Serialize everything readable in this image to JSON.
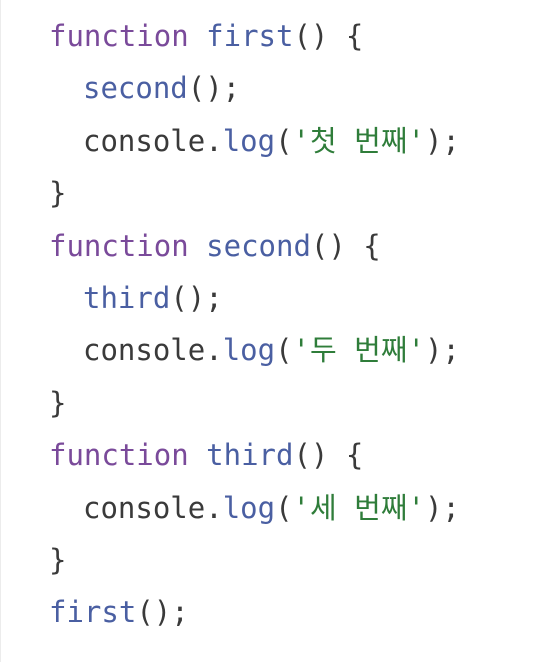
{
  "colors": {
    "background": "#ffffff",
    "keyword": "#7a4a9a",
    "function_name": "#4a5fa2",
    "plain": "#3a3a3a",
    "string": "#2f7d3a"
  },
  "code": {
    "line1": {
      "kw": "function",
      "name": "first",
      "rest": "() {"
    },
    "line2": {
      "call": "second",
      "rest": "();"
    },
    "line3": {
      "obj": "console",
      "dot": ".",
      "method": "log",
      "open": "(",
      "str": "'첫 번째'",
      "close": ");"
    },
    "line4": {
      "text": "}"
    },
    "line5": {
      "kw": "function",
      "name": "second",
      "rest": "() {"
    },
    "line6": {
      "call": "third",
      "rest": "();"
    },
    "line7": {
      "obj": "console",
      "dot": ".",
      "method": "log",
      "open": "(",
      "str": "'두 번째'",
      "close": ");"
    },
    "line8": {
      "text": "}"
    },
    "line9": {
      "kw": "function",
      "name": "third",
      "rest": "() {"
    },
    "line10": {
      "obj": "console",
      "dot": ".",
      "method": "log",
      "open": "(",
      "str": "'세 번째'",
      "close": ");"
    },
    "line11": {
      "text": "}"
    },
    "line12": {
      "call": "first",
      "rest": "();"
    }
  }
}
